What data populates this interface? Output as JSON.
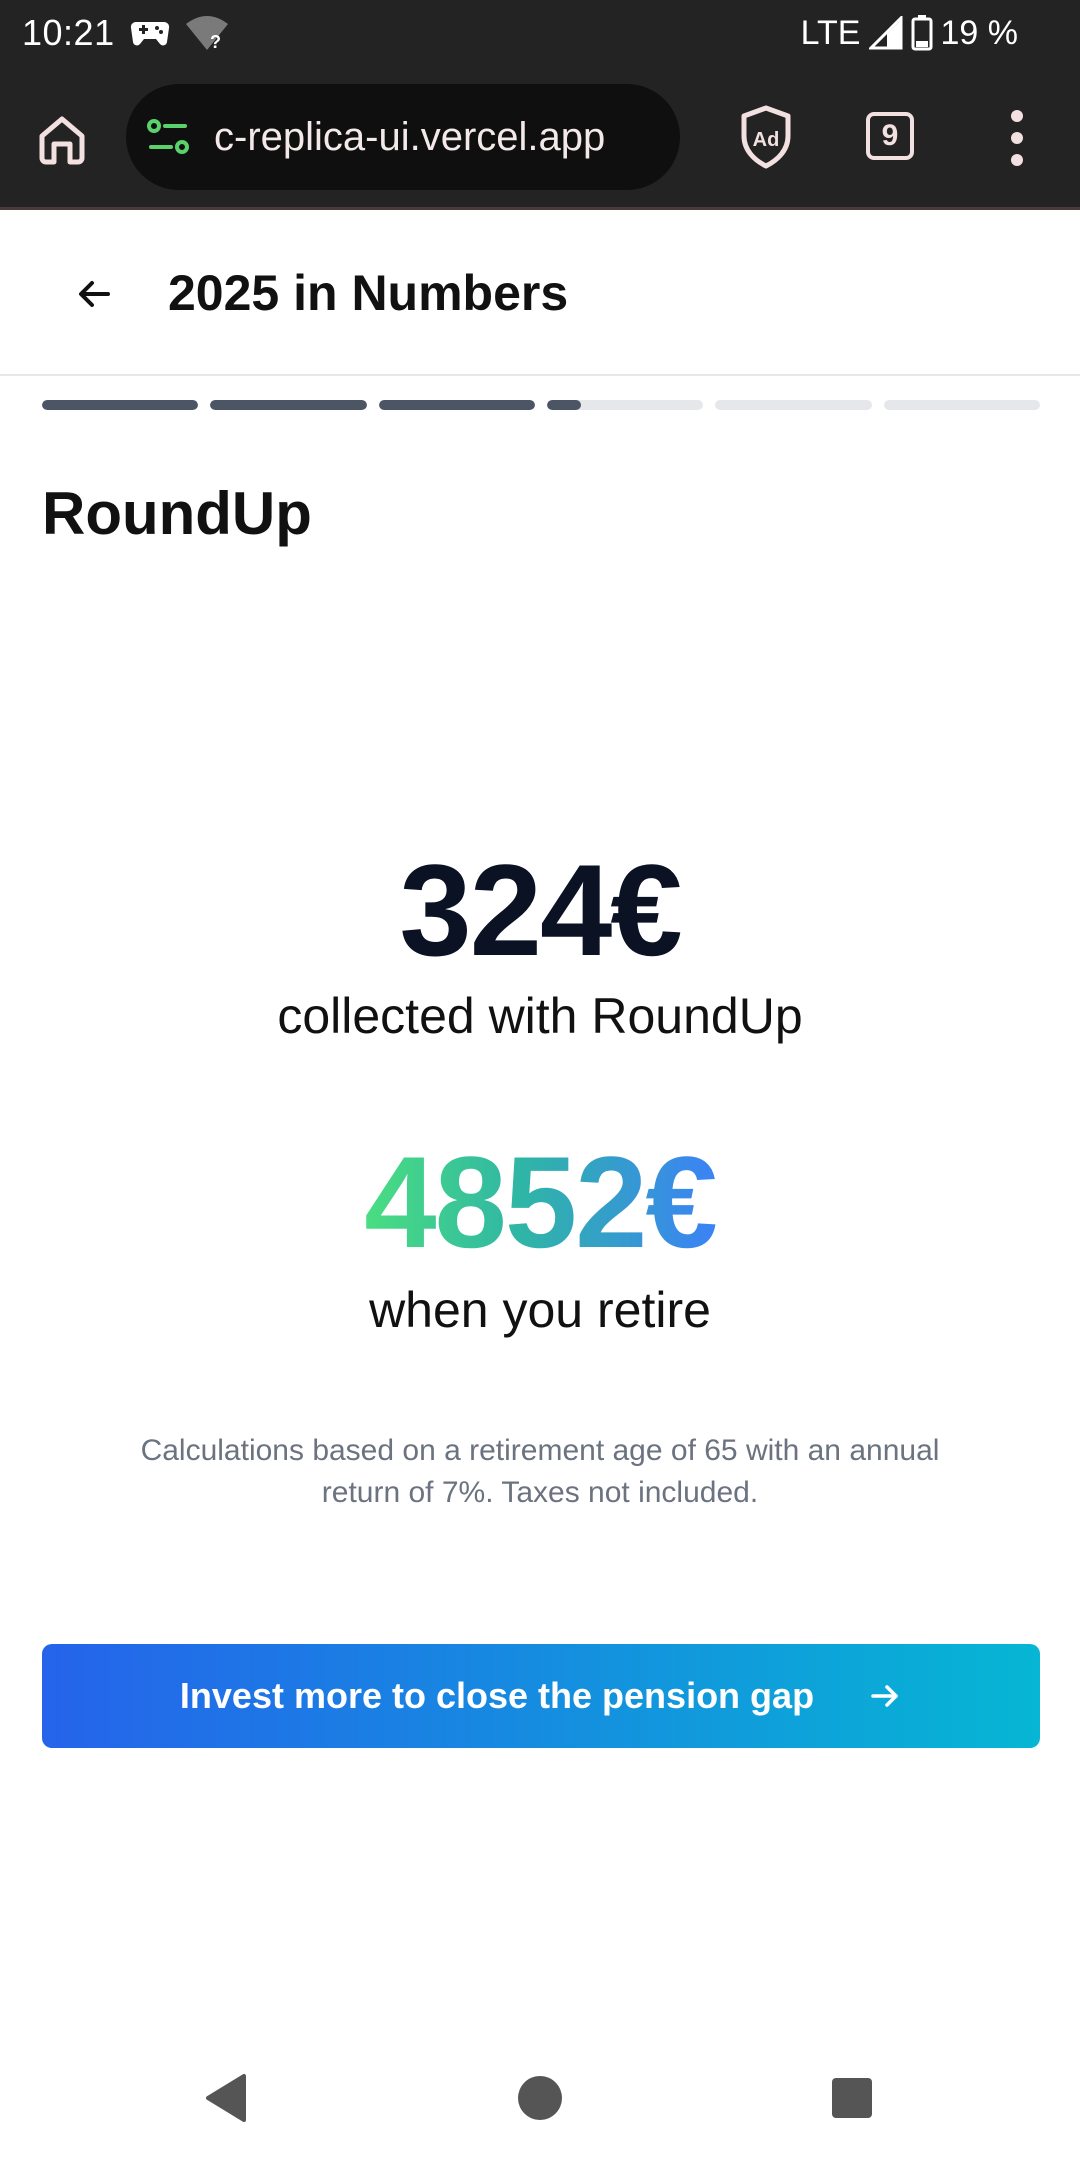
{
  "status_bar": {
    "time": "10:21",
    "network": "LTE",
    "battery": "19 %",
    "icons": [
      "game-controller-icon",
      "wifi-question-icon",
      "signal-icon",
      "battery-icon"
    ]
  },
  "browser": {
    "url": "c-replica-ui.vercel.app",
    "tab_count": "9",
    "adblock_label": "Ad",
    "icons": [
      "home-icon",
      "site-settings-icon",
      "adblock-shield-icon",
      "more-vert-icon"
    ]
  },
  "header": {
    "title": "2025 in Numbers",
    "back_icon": "arrow-left-icon"
  },
  "progress": {
    "segments": [
      1,
      1,
      1,
      0.22,
      0,
      0
    ],
    "fill_color": "#4b5563",
    "track_color": "#e5e7eb"
  },
  "main": {
    "section_title": "RoundUp",
    "collected_amount": "324€",
    "collected_label": "collected with RoundUp",
    "retire_amount": "4852€",
    "retire_label": "when you retire",
    "disclaimer": "Calculations based on a retirement age of 65 with an annual return of 7%. Taxes not included."
  },
  "cta": {
    "label": "Invest more to close the pension gap",
    "icon": "arrow-right-icon",
    "gradient_start": "#2563eb",
    "gradient_end": "#06b6d4"
  },
  "nav_bar": {
    "icons": [
      "nav-back-icon",
      "nav-home-icon",
      "nav-recents-icon"
    ]
  }
}
